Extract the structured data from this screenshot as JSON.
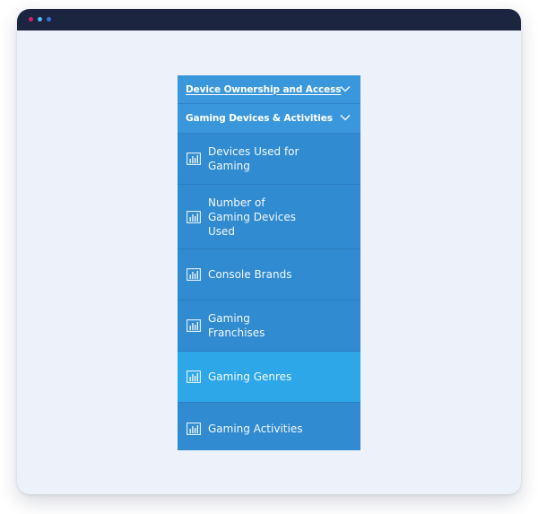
{
  "colors": {
    "window_bg": "#ecf1fa",
    "titlebar": "#1b2540",
    "dot_1": "#d4206a",
    "dot_2": "#4cc0f0",
    "dot_3": "#3a6fd8",
    "menu_bg": "#318bd0",
    "header_bg": "#3b97dc",
    "active_bg": "#2ea7e8"
  },
  "menu": {
    "sections": [
      {
        "label": "Device Ownership and Access",
        "icon": "chevron-down-icon",
        "expanded": false
      },
      {
        "label": "Gaming Devices & Activities",
        "icon": "chevron-down-icon",
        "expanded": true
      }
    ],
    "items": [
      {
        "label": "Devices Used for Gaming",
        "icon": "bar-chart-icon",
        "active": false
      },
      {
        "label": "Number of Gaming Devices Used",
        "icon": "bar-chart-icon",
        "active": false
      },
      {
        "label": "Console Brands",
        "icon": "bar-chart-icon",
        "active": false
      },
      {
        "label": "Gaming Franchises",
        "icon": "bar-chart-icon",
        "active": false
      },
      {
        "label": "Gaming Genres",
        "icon": "bar-chart-icon",
        "active": true
      },
      {
        "label": "Gaming Activities",
        "icon": "bar-chart-icon",
        "active": false
      }
    ]
  }
}
